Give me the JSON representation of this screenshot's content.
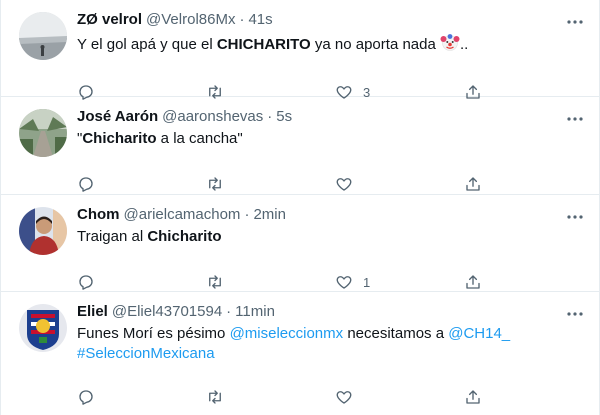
{
  "tweets": [
    {
      "name": "ZØ velrol",
      "handle": "@Velrol86Mx",
      "time": "41s",
      "text_parts": [
        "Y el gol apá y que el ",
        "CHICHARITO",
        " ya no aporta nada ",
        "..",
        ""
      ],
      "emoji": "clown-face",
      "reply_count": "",
      "retweet_count": "",
      "like_count": "3"
    },
    {
      "name": "José Aarón",
      "handle": "@aaronshevas",
      "time": "5s",
      "text_parts": [
        "\"",
        "Chicharito",
        " a la cancha\""
      ],
      "reply_count": "",
      "retweet_count": "",
      "like_count": ""
    },
    {
      "name": "Chom",
      "handle": "@arielcamachom",
      "time": "2min",
      "text_parts": [
        "Traigan al ",
        "Chicharito"
      ],
      "reply_count": "",
      "retweet_count": "",
      "like_count": "1"
    },
    {
      "name": "Eliel",
      "handle": "@Eliel43701594",
      "time": "11min",
      "text_parts": [
        "Funes Morí es pésimo ",
        "@miseleccionmx",
        "  necesitamos a ",
        "@CH14_",
        "#SeleccionMexicana"
      ],
      "reply_count": "",
      "retweet_count": "",
      "like_count": ""
    }
  ],
  "separator": "·",
  "colors": {
    "link": "#1d9bf0",
    "secondary": "#536471",
    "border": "#e6ecf0"
  }
}
